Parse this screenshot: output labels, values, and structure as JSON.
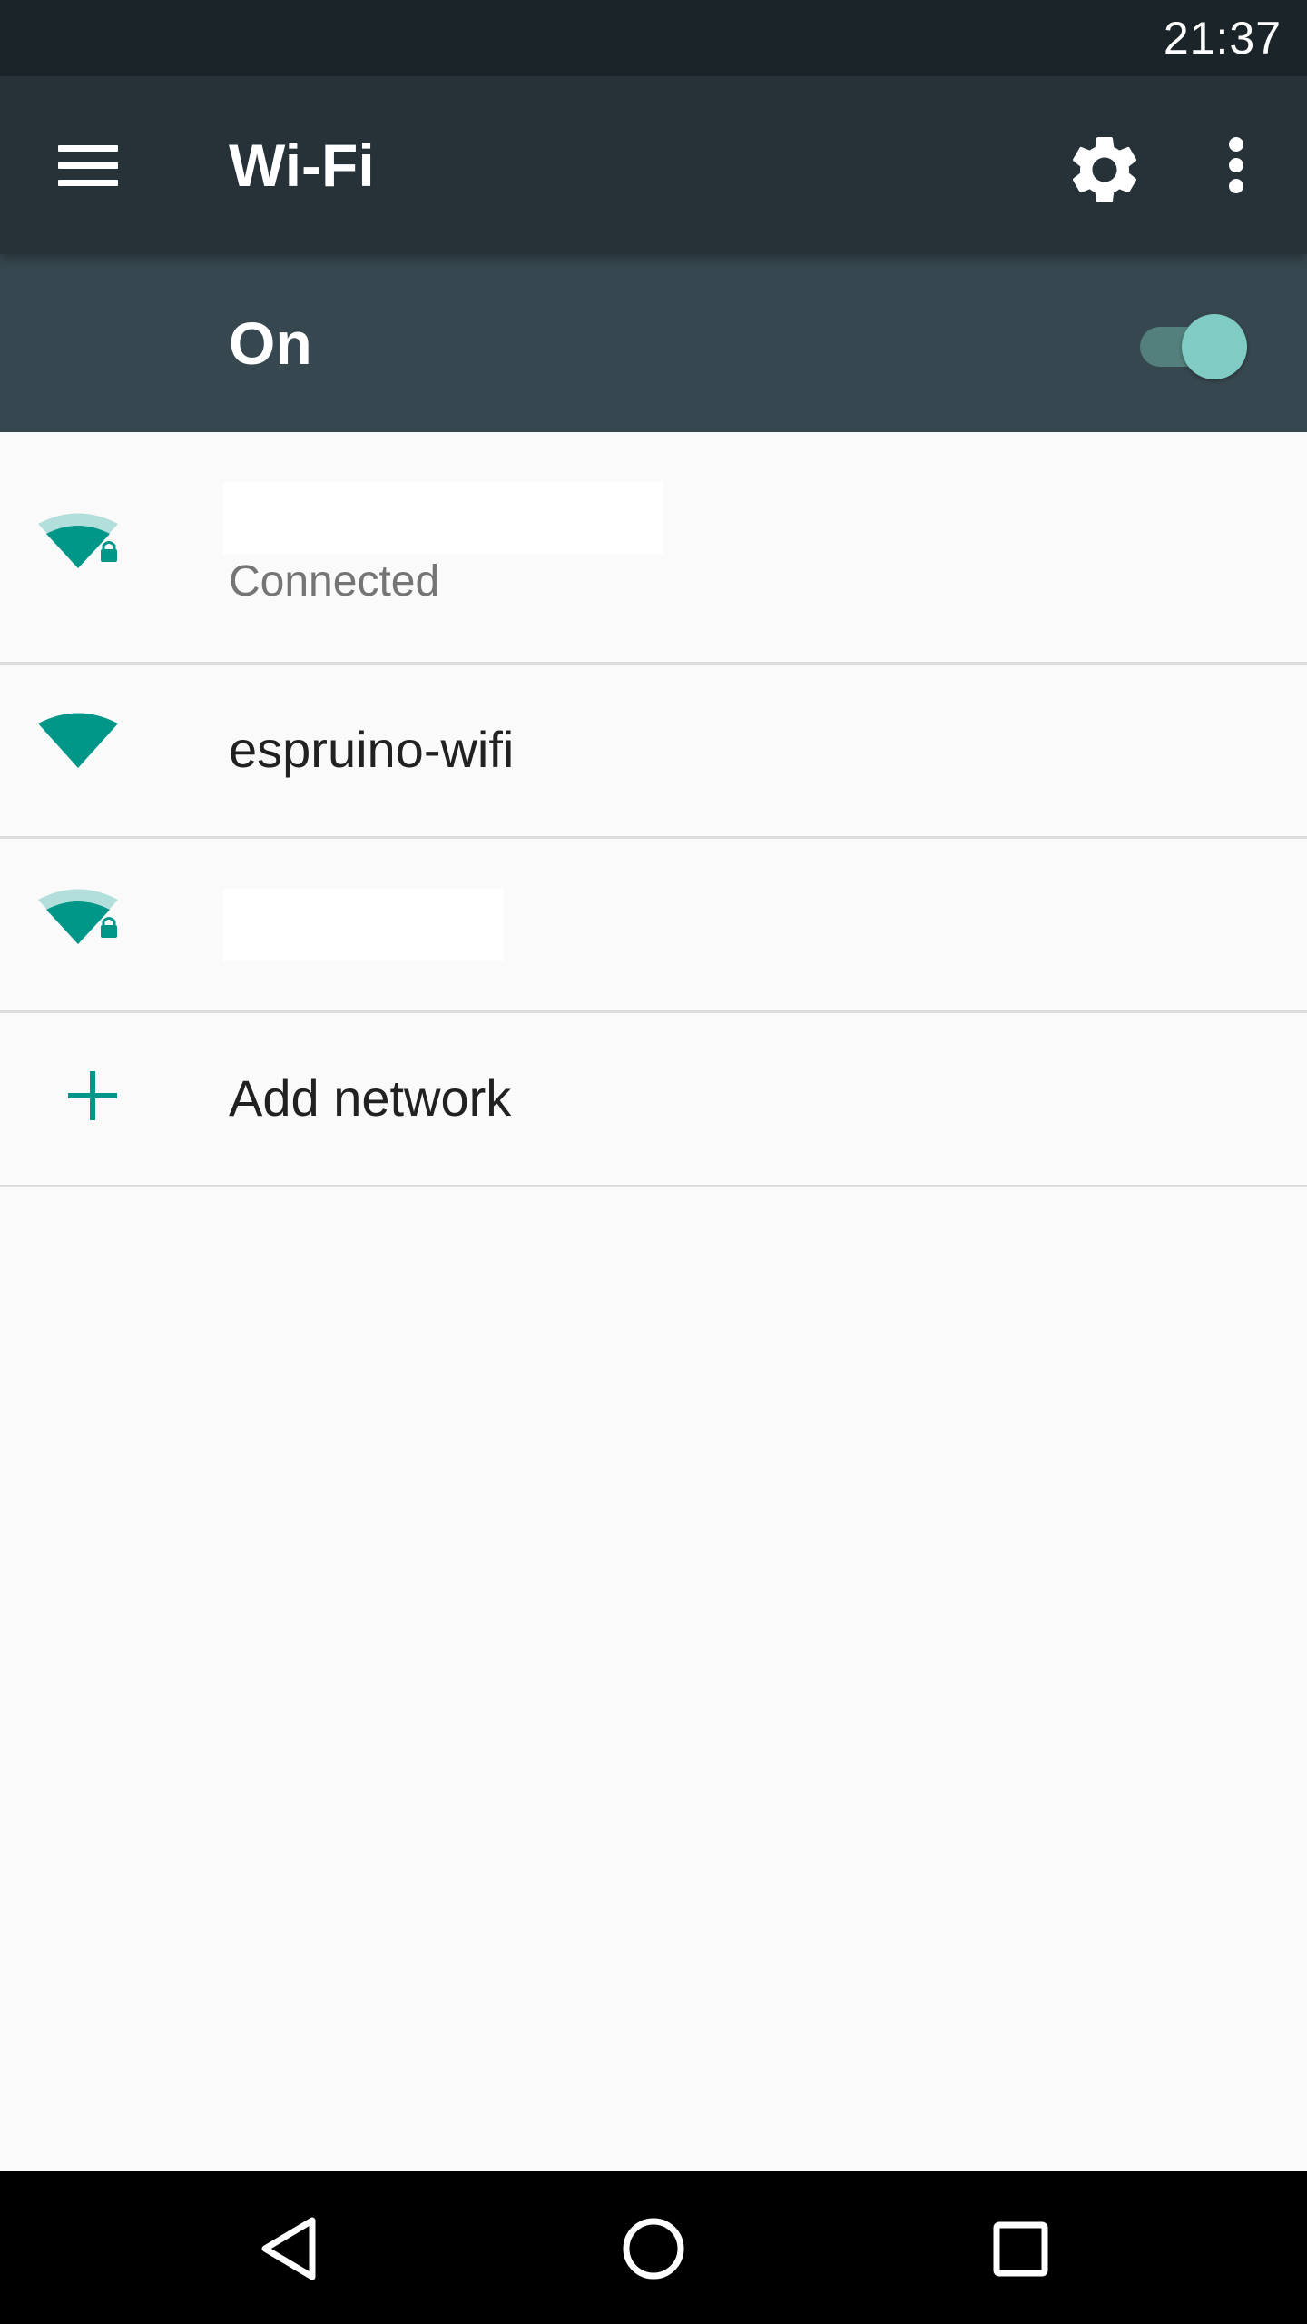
{
  "status_bar": {
    "time": "21:37"
  },
  "app_bar": {
    "title": "Wi-Fi",
    "menu_icon": "hamburger-menu-icon",
    "settings_icon": "gear-icon",
    "overflow_icon": "more-vertical-icon"
  },
  "wifi_switch": {
    "label": "On",
    "state": "on"
  },
  "networks": [
    {
      "name": "",
      "status": "Connected",
      "signal_icon": "wifi-signal-secured-icon"
    },
    {
      "name": "espruino-wifi",
      "status": "",
      "signal_icon": "wifi-signal-full-icon"
    },
    {
      "name": "",
      "status": "",
      "signal_icon": "wifi-signal-secured-icon"
    }
  ],
  "add_network": {
    "label": "Add network",
    "icon": "plus-icon"
  },
  "nav_bar": {
    "back_icon": "back-triangle-icon",
    "home_icon": "home-circle-icon",
    "recents_icon": "recents-square-icon"
  },
  "colors": {
    "status_bar": "#1b2429",
    "app_bar": "#263238",
    "switch_bar": "#37474f",
    "accent": "#009688",
    "toggle_thumb": "#80cbc4",
    "background": "#fafafa"
  }
}
